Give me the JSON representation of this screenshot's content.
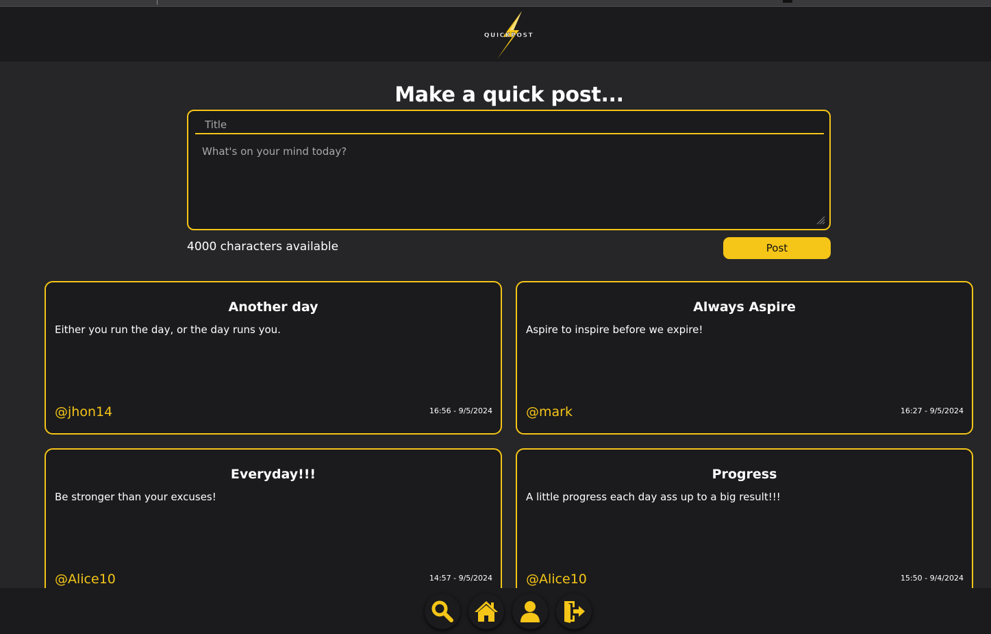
{
  "app": {
    "logo_text": "QUICKPOST"
  },
  "composer": {
    "heading": "Make a quick post...",
    "title_placeholder": "Title",
    "body_placeholder": "What's on your mind today?",
    "char_count": "4000 characters available",
    "post_label": "Post"
  },
  "posts": [
    {
      "title": "Another day",
      "body": "Either you run the day, or the day runs you.",
      "author": "@jhon14",
      "time": "16:56 - 9/5/2024"
    },
    {
      "title": "Always Aspire",
      "body": "Aspire to inspire before we expire!",
      "author": "@mark",
      "time": "16:27 - 9/5/2024"
    },
    {
      "title": "Everyday!!!",
      "body": "Be stronger than your excuses!",
      "author": "@Alice10",
      "time": "14:57 - 9/5/2024"
    },
    {
      "title": "Progress",
      "body": "A little progress each day ass up to a big result!!!",
      "author": "@Alice10",
      "time": "15:50 - 9/4/2024"
    }
  ],
  "nav": {
    "icons": [
      "search-icon",
      "home-icon",
      "user-icon",
      "logout-icon"
    ]
  },
  "colors": {
    "accent": "#f5c518",
    "background": "#262628",
    "surface": "#1b1b1d"
  }
}
